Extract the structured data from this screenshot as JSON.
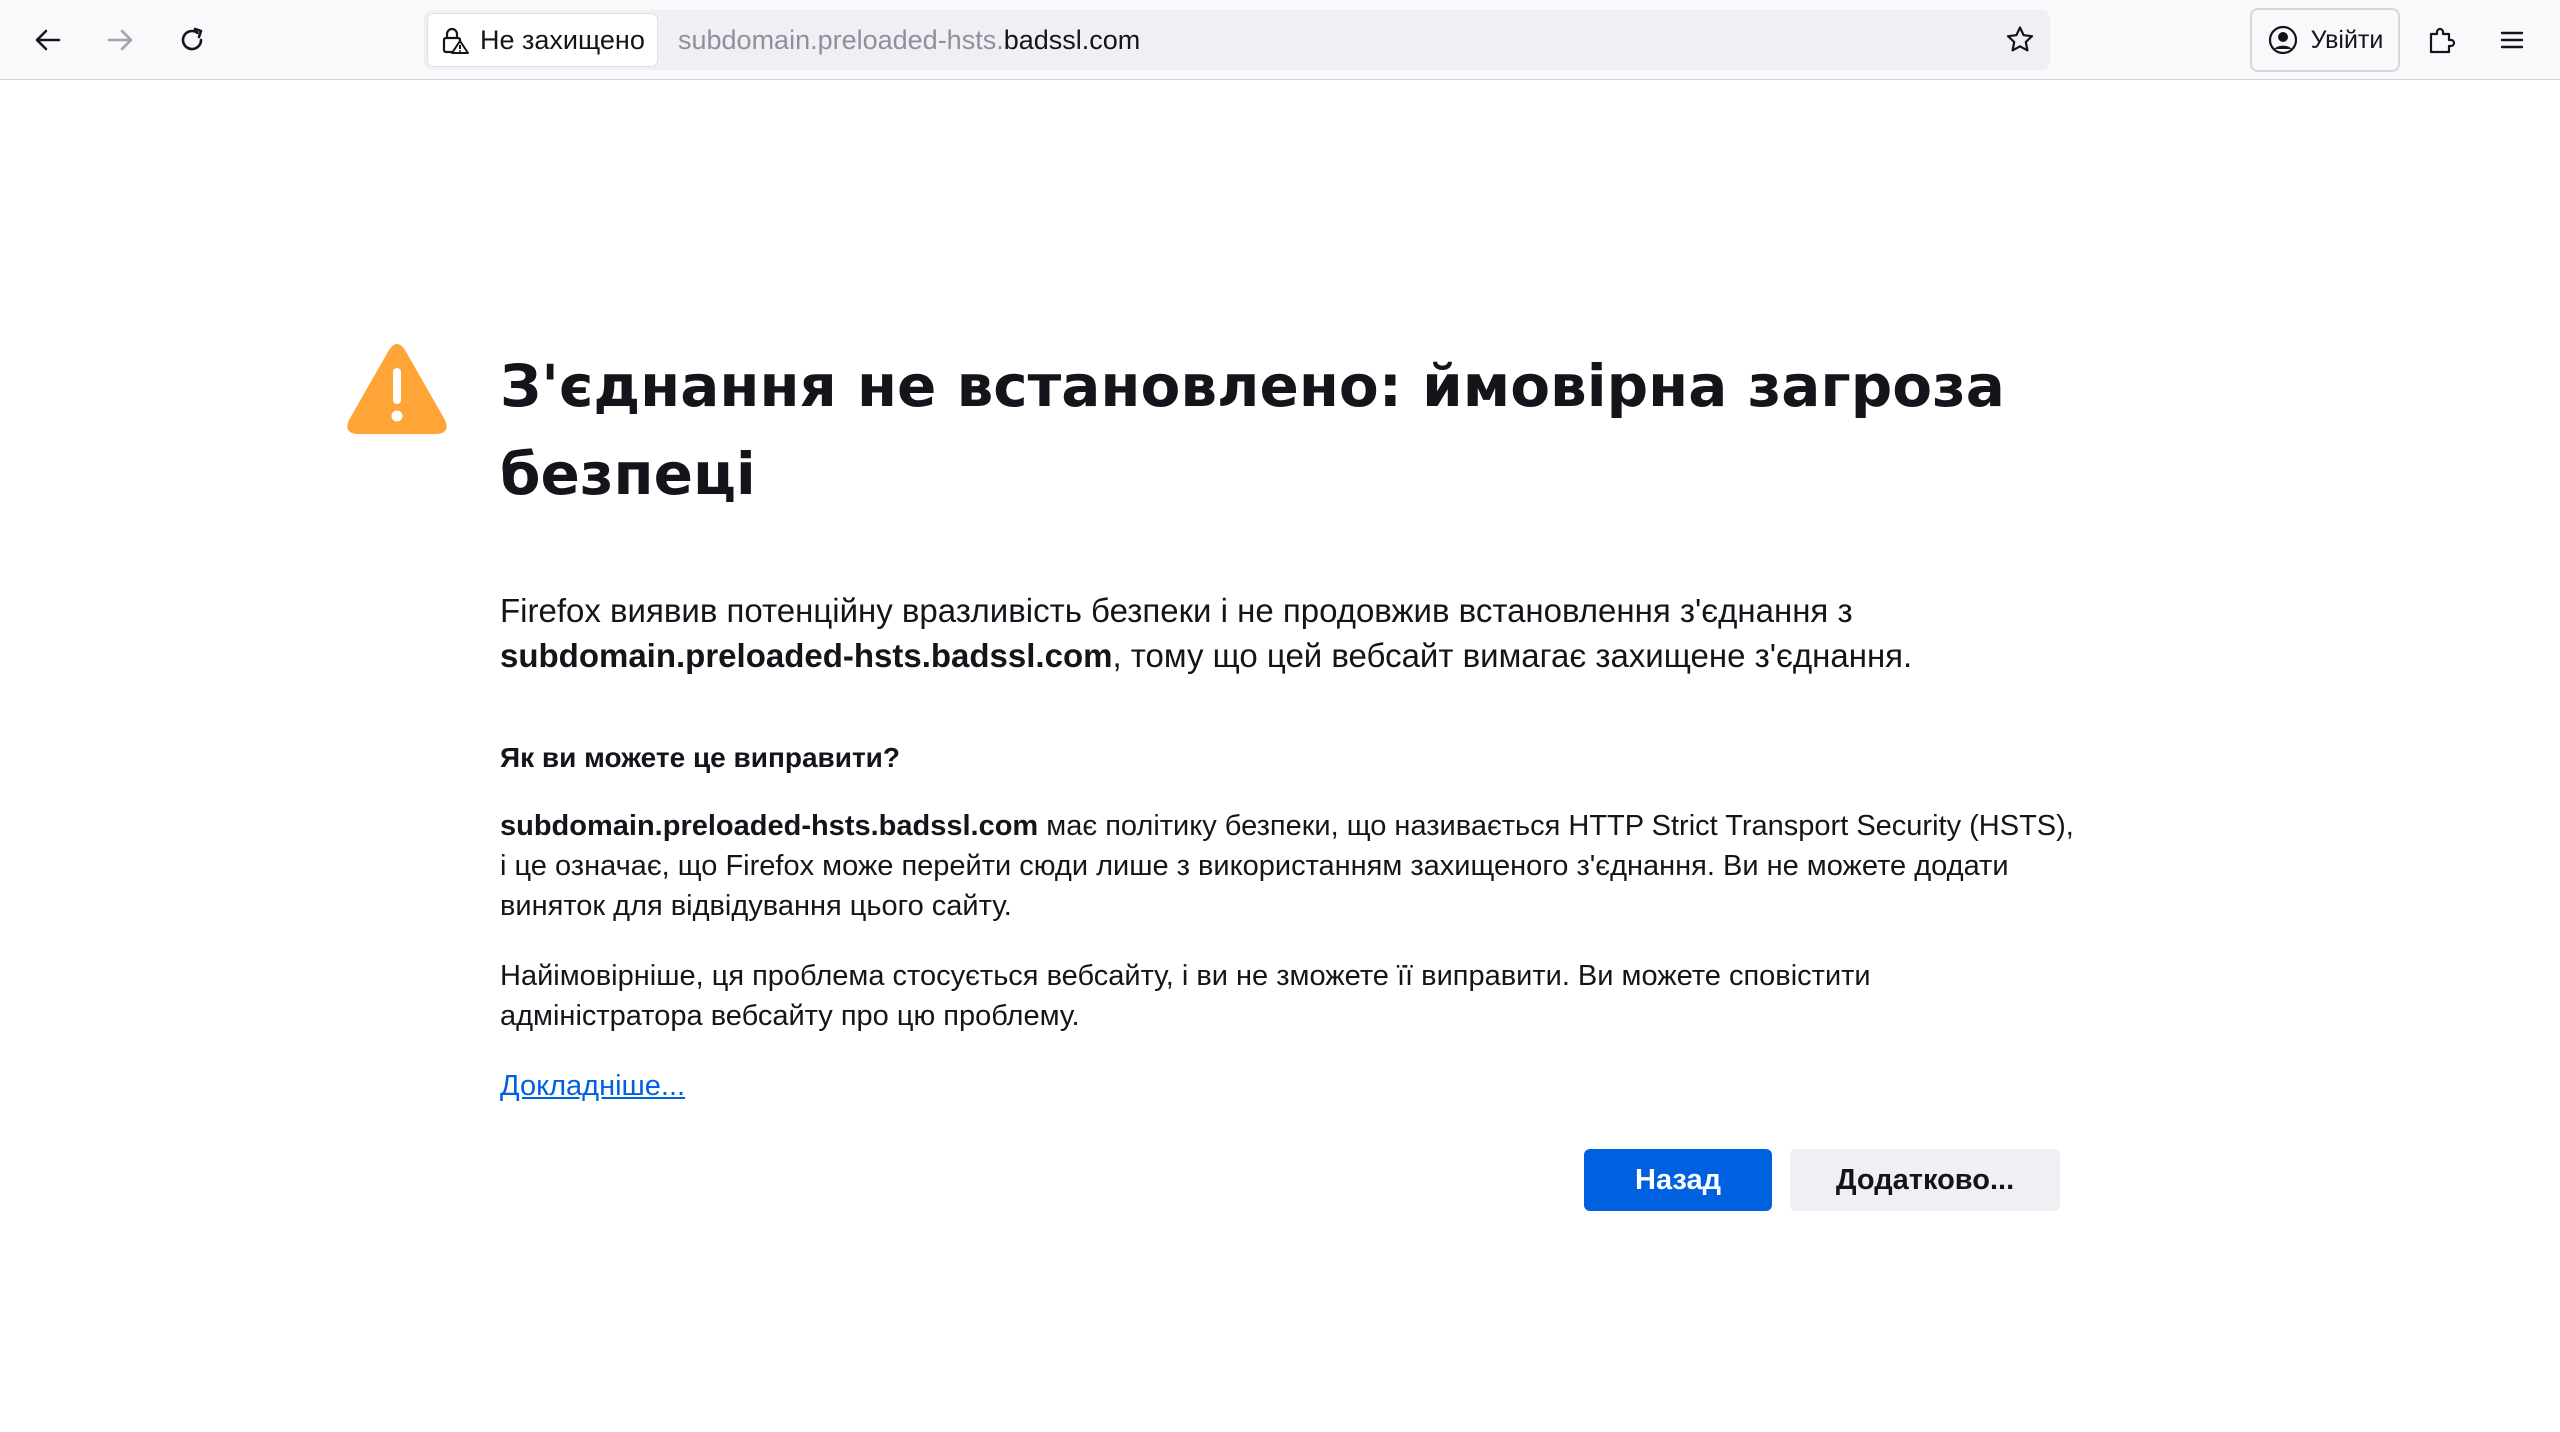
{
  "toolbar": {
    "back_icon": "arrow-left-icon",
    "forward_icon": "arrow-right-icon",
    "reload_icon": "reload-icon",
    "identity_label": "Не захищено",
    "identity_icon": "lock-warning-icon",
    "url_prefix": "subdomain.preloaded-hsts.",
    "url_domain": "badssl.com",
    "bookmark_icon": "star-icon",
    "signin_label": "Увійти",
    "signin_icon": "account-icon",
    "extensions_icon": "puzzle-icon",
    "menu_icon": "hamburger-menu-icon"
  },
  "error": {
    "icon": "warning-icon",
    "icon_color": "#ffa436",
    "title": "З'єднання не встановлено: ймовірна загроза безпеці",
    "intro_text": "Firefox виявив потенційну вразливість безпеки і не продовжив встановлення з'єднання з ",
    "intro_host": "subdomain.preloaded-hsts.badssl.com",
    "intro_suffix": ", тому що цей вебсайт вимагає захищене з'єднання.",
    "howto_heading": "Як ви можете це виправити?",
    "para1_host": "subdomain.preloaded-hsts.badssl.com",
    "para1_text": " має політику безпеки, що називається HTTP Strict Transport Security (HSTS), і це означає, що Firefox може перейти сюди лише з використанням захищеного з'єднання. Ви не можете додати виняток для відвідування цього сайту.",
    "para2_text": "Найімовірніше, ця проблема стосується вебсайту, і ви не зможете її виправити. Ви можете сповістити адміністратора вебсайту про цю проблему.",
    "learn_more": "Докладніше...",
    "back_button": "Назад",
    "advanced_button": "Додатково..."
  },
  "colors": {
    "primary_button": "#0061e0",
    "link": "#0061e0",
    "warning": "#ffa436"
  }
}
